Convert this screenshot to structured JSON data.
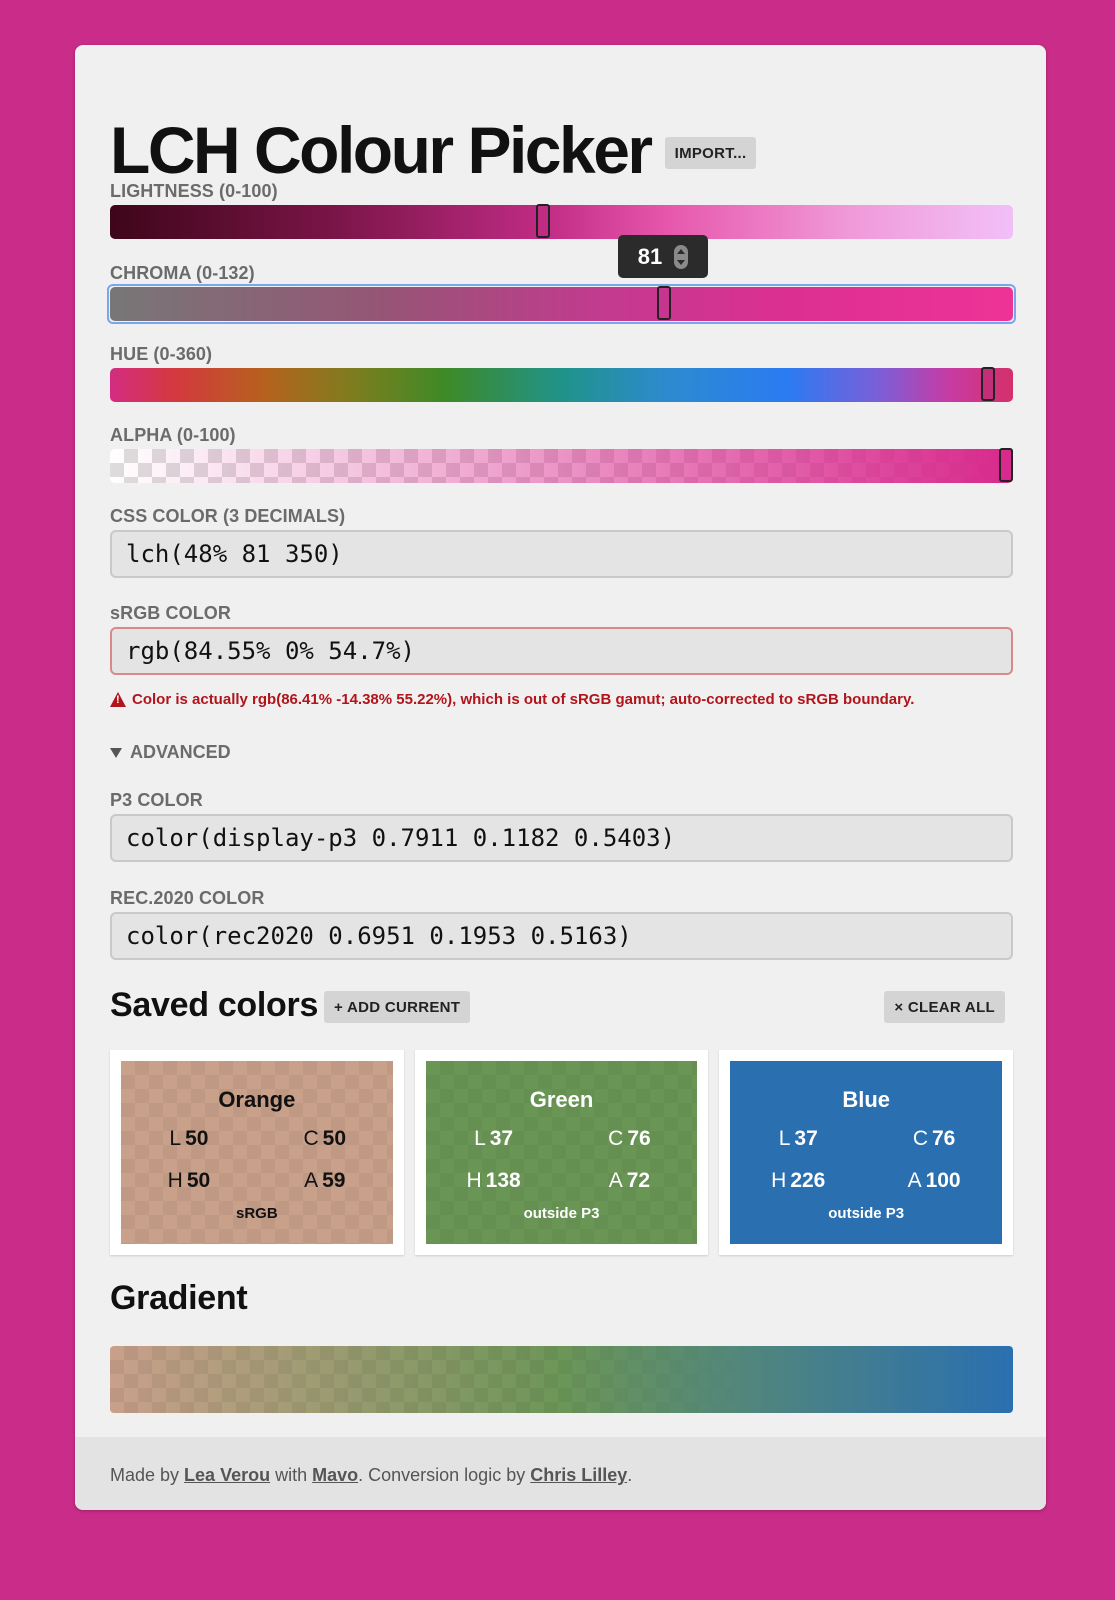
{
  "title": "LCH Colour Picker",
  "import_label": "IMPORT...",
  "sliders": {
    "lightness": {
      "label": "LIGHTNESS (0-100)",
      "value": 48,
      "max": 100
    },
    "chroma": {
      "label": "CHROMA (0-132)",
      "value": 81,
      "max": 132,
      "tooltip": "81"
    },
    "hue": {
      "label": "HUE (0-360)",
      "value": 350,
      "max": 360
    },
    "alpha": {
      "label": "ALPHA (0-100)",
      "value": 100,
      "max": 100
    }
  },
  "css_color": {
    "label": "CSS COLOR (3 DECIMALS)",
    "value": "lch(48% 81 350)"
  },
  "srgb_color": {
    "label": "sRGB COLOR",
    "value": "rgb(84.55% 0% 54.7%)",
    "warning": "Color is actually rgb(86.41% -14.38% 55.22%), which is out of sRGB gamut; auto-corrected to sRGB boundary."
  },
  "advanced_label": "ADVANCED",
  "p3_color": {
    "label": "P3 COLOR",
    "value": "color(display-p3 0.7911 0.1182 0.5403)"
  },
  "rec2020_color": {
    "label": "REC.2020 COLOR",
    "value": "color(rec2020 0.6951 0.1953 0.5163)"
  },
  "saved": {
    "heading": "Saved colors",
    "add_label": "+ ADD CURRENT",
    "clear_label": "× CLEAR ALL",
    "colors": [
      {
        "name": "Orange",
        "L": "50",
        "C": "50",
        "H": "50",
        "A": "59",
        "gamut": "sRGB",
        "bg": "#c9a08a",
        "fg": "#111111"
      },
      {
        "name": "Green",
        "L": "37",
        "C": "76",
        "H": "138",
        "A": "72",
        "gamut": "outside P3",
        "bg": "#6a9655",
        "fg": "#ffffff"
      },
      {
        "name": "Blue",
        "L": "37",
        "C": "76",
        "H": "226",
        "A": "100",
        "gamut": "outside P3",
        "bg": "#2a6faf",
        "fg": "#ffffff"
      }
    ],
    "keys": {
      "L": "L",
      "C": "C",
      "H": "H",
      "A": "A"
    }
  },
  "gradient_heading": "Gradient",
  "footer": {
    "made_by": "Made by ",
    "author": "Lea Verou",
    "with": " with ",
    "tool": "Mavo",
    "logic": ". Conversion logic by ",
    "logic_author": "Chris Lilley",
    "end": "."
  },
  "colors": {
    "page_bg": "#c92c89",
    "current": "#d8298c",
    "error": "#b1141b",
    "focus": "#7aa6ef"
  }
}
